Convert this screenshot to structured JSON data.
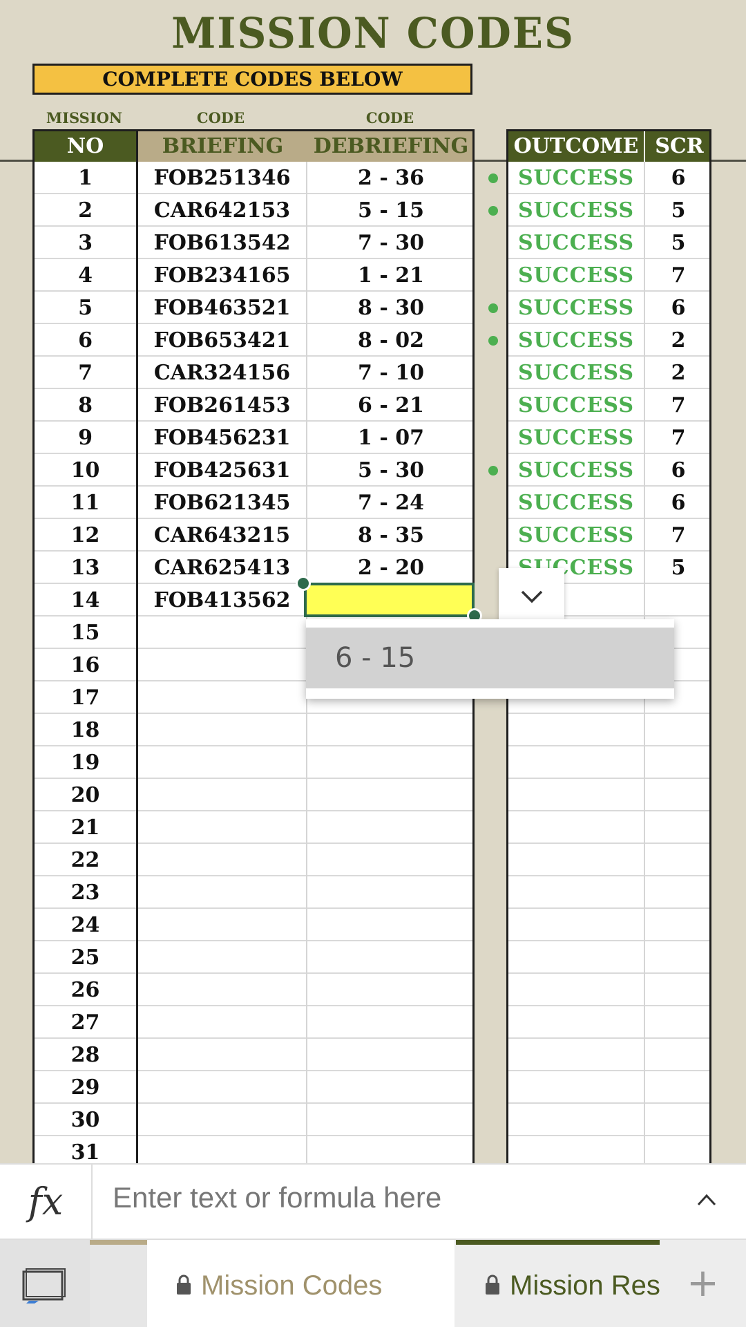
{
  "title": "MISSION CODES",
  "banner": "COMPLETE CODES BELOW",
  "subheaders": {
    "mission": "MISSION",
    "code_left": "CODE",
    "code_right": "CODE"
  },
  "left_headers": {
    "no": "NO",
    "briefing": "BRIEFING",
    "debriefing": "DEBRIEFING"
  },
  "right_headers": {
    "outcome": "OUTCOME",
    "scr": "SCR"
  },
  "rows": [
    {
      "no": "1",
      "briefing": "FOB251346",
      "debriefing": "2 - 36",
      "outcome": "SUCCESS",
      "scr": "6",
      "dot": true
    },
    {
      "no": "2",
      "briefing": "CAR642153",
      "debriefing": "5 - 15",
      "outcome": "SUCCESS",
      "scr": "5",
      "dot": true
    },
    {
      "no": "3",
      "briefing": "FOB613542",
      "debriefing": "7 - 30",
      "outcome": "SUCCESS",
      "scr": "5",
      "dot": false
    },
    {
      "no": "4",
      "briefing": "FOB234165",
      "debriefing": "1 - 21",
      "outcome": "SUCCESS",
      "scr": "7",
      "dot": false
    },
    {
      "no": "5",
      "briefing": "FOB463521",
      "debriefing": "8 - 30",
      "outcome": "SUCCESS",
      "scr": "6",
      "dot": true
    },
    {
      "no": "6",
      "briefing": "FOB653421",
      "debriefing": "8 - 02",
      "outcome": "SUCCESS",
      "scr": "2",
      "dot": true
    },
    {
      "no": "7",
      "briefing": "CAR324156",
      "debriefing": "7 - 10",
      "outcome": "SUCCESS",
      "scr": "2",
      "dot": false
    },
    {
      "no": "8",
      "briefing": "FOB261453",
      "debriefing": "6 - 21",
      "outcome": "SUCCESS",
      "scr": "7",
      "dot": false
    },
    {
      "no": "9",
      "briefing": "FOB456231",
      "debriefing": "1 - 07",
      "outcome": "SUCCESS",
      "scr": "7",
      "dot": false
    },
    {
      "no": "10",
      "briefing": "FOB425631",
      "debriefing": "5 - 30",
      "outcome": "SUCCESS",
      "scr": "6",
      "dot": true
    },
    {
      "no": "11",
      "briefing": "FOB621345",
      "debriefing": "7 - 24",
      "outcome": "SUCCESS",
      "scr": "6",
      "dot": false
    },
    {
      "no": "12",
      "briefing": "CAR643215",
      "debriefing": "8 - 35",
      "outcome": "SUCCESS",
      "scr": "7",
      "dot": false
    },
    {
      "no": "13",
      "briefing": "CAR625413",
      "debriefing": "2 - 20",
      "outcome": "SUCCESS",
      "scr": "5",
      "dot": false
    },
    {
      "no": "14",
      "briefing": "FOB413562",
      "debriefing": "",
      "outcome": "",
      "scr": "",
      "dot": false
    },
    {
      "no": "15",
      "briefing": "",
      "debriefing": "",
      "outcome": "",
      "scr": "",
      "dot": false
    },
    {
      "no": "16",
      "briefing": "",
      "debriefing": "",
      "outcome": "",
      "scr": "",
      "dot": false
    },
    {
      "no": "17",
      "briefing": "",
      "debriefing": "",
      "outcome": "",
      "scr": "",
      "dot": false
    },
    {
      "no": "18",
      "briefing": "",
      "debriefing": "",
      "outcome": "",
      "scr": "",
      "dot": false
    },
    {
      "no": "19",
      "briefing": "",
      "debriefing": "",
      "outcome": "",
      "scr": "",
      "dot": false
    },
    {
      "no": "20",
      "briefing": "",
      "debriefing": "",
      "outcome": "",
      "scr": "",
      "dot": false
    },
    {
      "no": "21",
      "briefing": "",
      "debriefing": "",
      "outcome": "",
      "scr": "",
      "dot": false
    },
    {
      "no": "22",
      "briefing": "",
      "debriefing": "",
      "outcome": "",
      "scr": "",
      "dot": false
    },
    {
      "no": "23",
      "briefing": "",
      "debriefing": "",
      "outcome": "",
      "scr": "",
      "dot": false
    },
    {
      "no": "24",
      "briefing": "",
      "debriefing": "",
      "outcome": "",
      "scr": "",
      "dot": false
    },
    {
      "no": "25",
      "briefing": "",
      "debriefing": "",
      "outcome": "",
      "scr": "",
      "dot": false
    },
    {
      "no": "26",
      "briefing": "",
      "debriefing": "",
      "outcome": "",
      "scr": "",
      "dot": false
    },
    {
      "no": "27",
      "briefing": "",
      "debriefing": "",
      "outcome": "",
      "scr": "",
      "dot": false
    },
    {
      "no": "28",
      "briefing": "",
      "debriefing": "",
      "outcome": "",
      "scr": "",
      "dot": false
    },
    {
      "no": "29",
      "briefing": "",
      "debriefing": "",
      "outcome": "",
      "scr": "",
      "dot": false
    },
    {
      "no": "30",
      "briefing": "",
      "debriefing": "",
      "outcome": "",
      "scr": "",
      "dot": false
    },
    {
      "no": "31",
      "briefing": "",
      "debriefing": "",
      "outcome": "",
      "scr": "",
      "dot": false
    }
  ],
  "dropdown": {
    "option": "6 - 15",
    "icon": "chevron-down-icon"
  },
  "formula_bar": {
    "fx_label": "fx",
    "placeholder": "Enter text or formula here",
    "icon": "chevron-up-icon"
  },
  "tabs": [
    {
      "label": "Mission Codes",
      "active": true,
      "icon": "lock-icon"
    },
    {
      "label": "Mission Res",
      "active": false,
      "icon": "lock-icon"
    }
  ],
  "add_sheet_label": "+",
  "colors": {
    "olive": "#4B5A21",
    "tan": "#B9AB88",
    "background": "#DDD8C7",
    "banner": "#F4C142",
    "success": "#4CAF50",
    "selection": "#FFFF55",
    "accent": "#2E6B4C"
  }
}
